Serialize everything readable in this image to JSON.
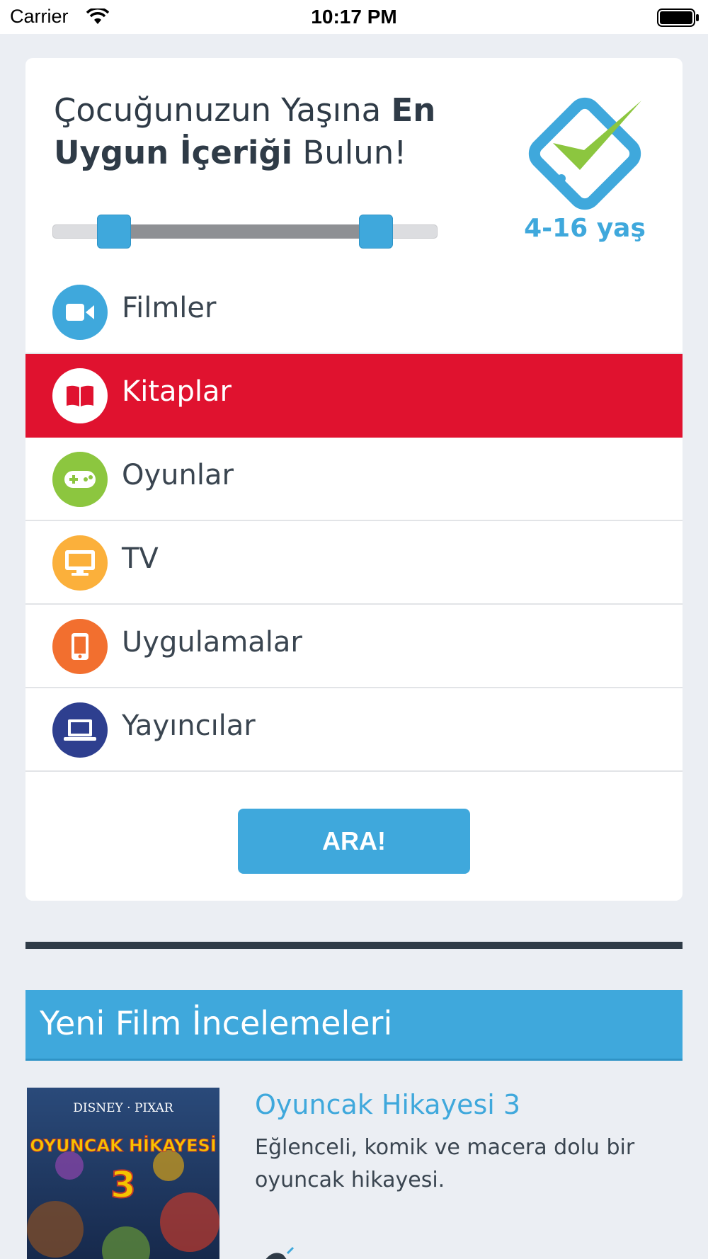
{
  "status_bar": {
    "carrier": "Carrier",
    "time": "10:17 PM"
  },
  "finder": {
    "title_part1": "Çocuğunuzun Yaşına ",
    "title_bold": "En Uygun İçeriği",
    "title_part2": " Bulun!",
    "age_range": "4-16 yaş",
    "slider": {
      "min_fraction": 0.16,
      "max_fraction": 0.84
    },
    "categories": [
      {
        "label": "Filmler",
        "icon": "video-camera-icon",
        "color": "#3fa8dc",
        "active": false
      },
      {
        "label": "Kitaplar",
        "icon": "book-icon",
        "color": "#ffffff",
        "active": true
      },
      {
        "label": "Oyunlar",
        "icon": "gamepad-icon",
        "color": "#8cc63f",
        "active": false
      },
      {
        "label": "TV",
        "icon": "monitor-icon",
        "color": "#fbb03b",
        "active": false
      },
      {
        "label": "Uygulamalar",
        "icon": "phone-icon",
        "color": "#f26f2f",
        "active": false
      },
      {
        "label": "Yayıncılar",
        "icon": "laptop-icon",
        "color": "#2e3f8f",
        "active": false
      }
    ],
    "search_button": "ARA!"
  },
  "reviews_section": {
    "title": "Yeni Film İncelemeleri",
    "items": [
      {
        "title": "Oyuncak Hikayesi 3",
        "text": "Eğlenceli, komik ve macera dolu bir oyuncak hikayesi.",
        "poster_brand": "DISNEY · PIXAR",
        "poster_title": "OYUNCAK HİKAYESİ",
        "poster_number": "3"
      }
    ]
  },
  "colors": {
    "accent_blue": "#3fa8dc",
    "active_red": "#e0122f",
    "text_dark": "#2f3b47",
    "background": "#ebeef3"
  }
}
